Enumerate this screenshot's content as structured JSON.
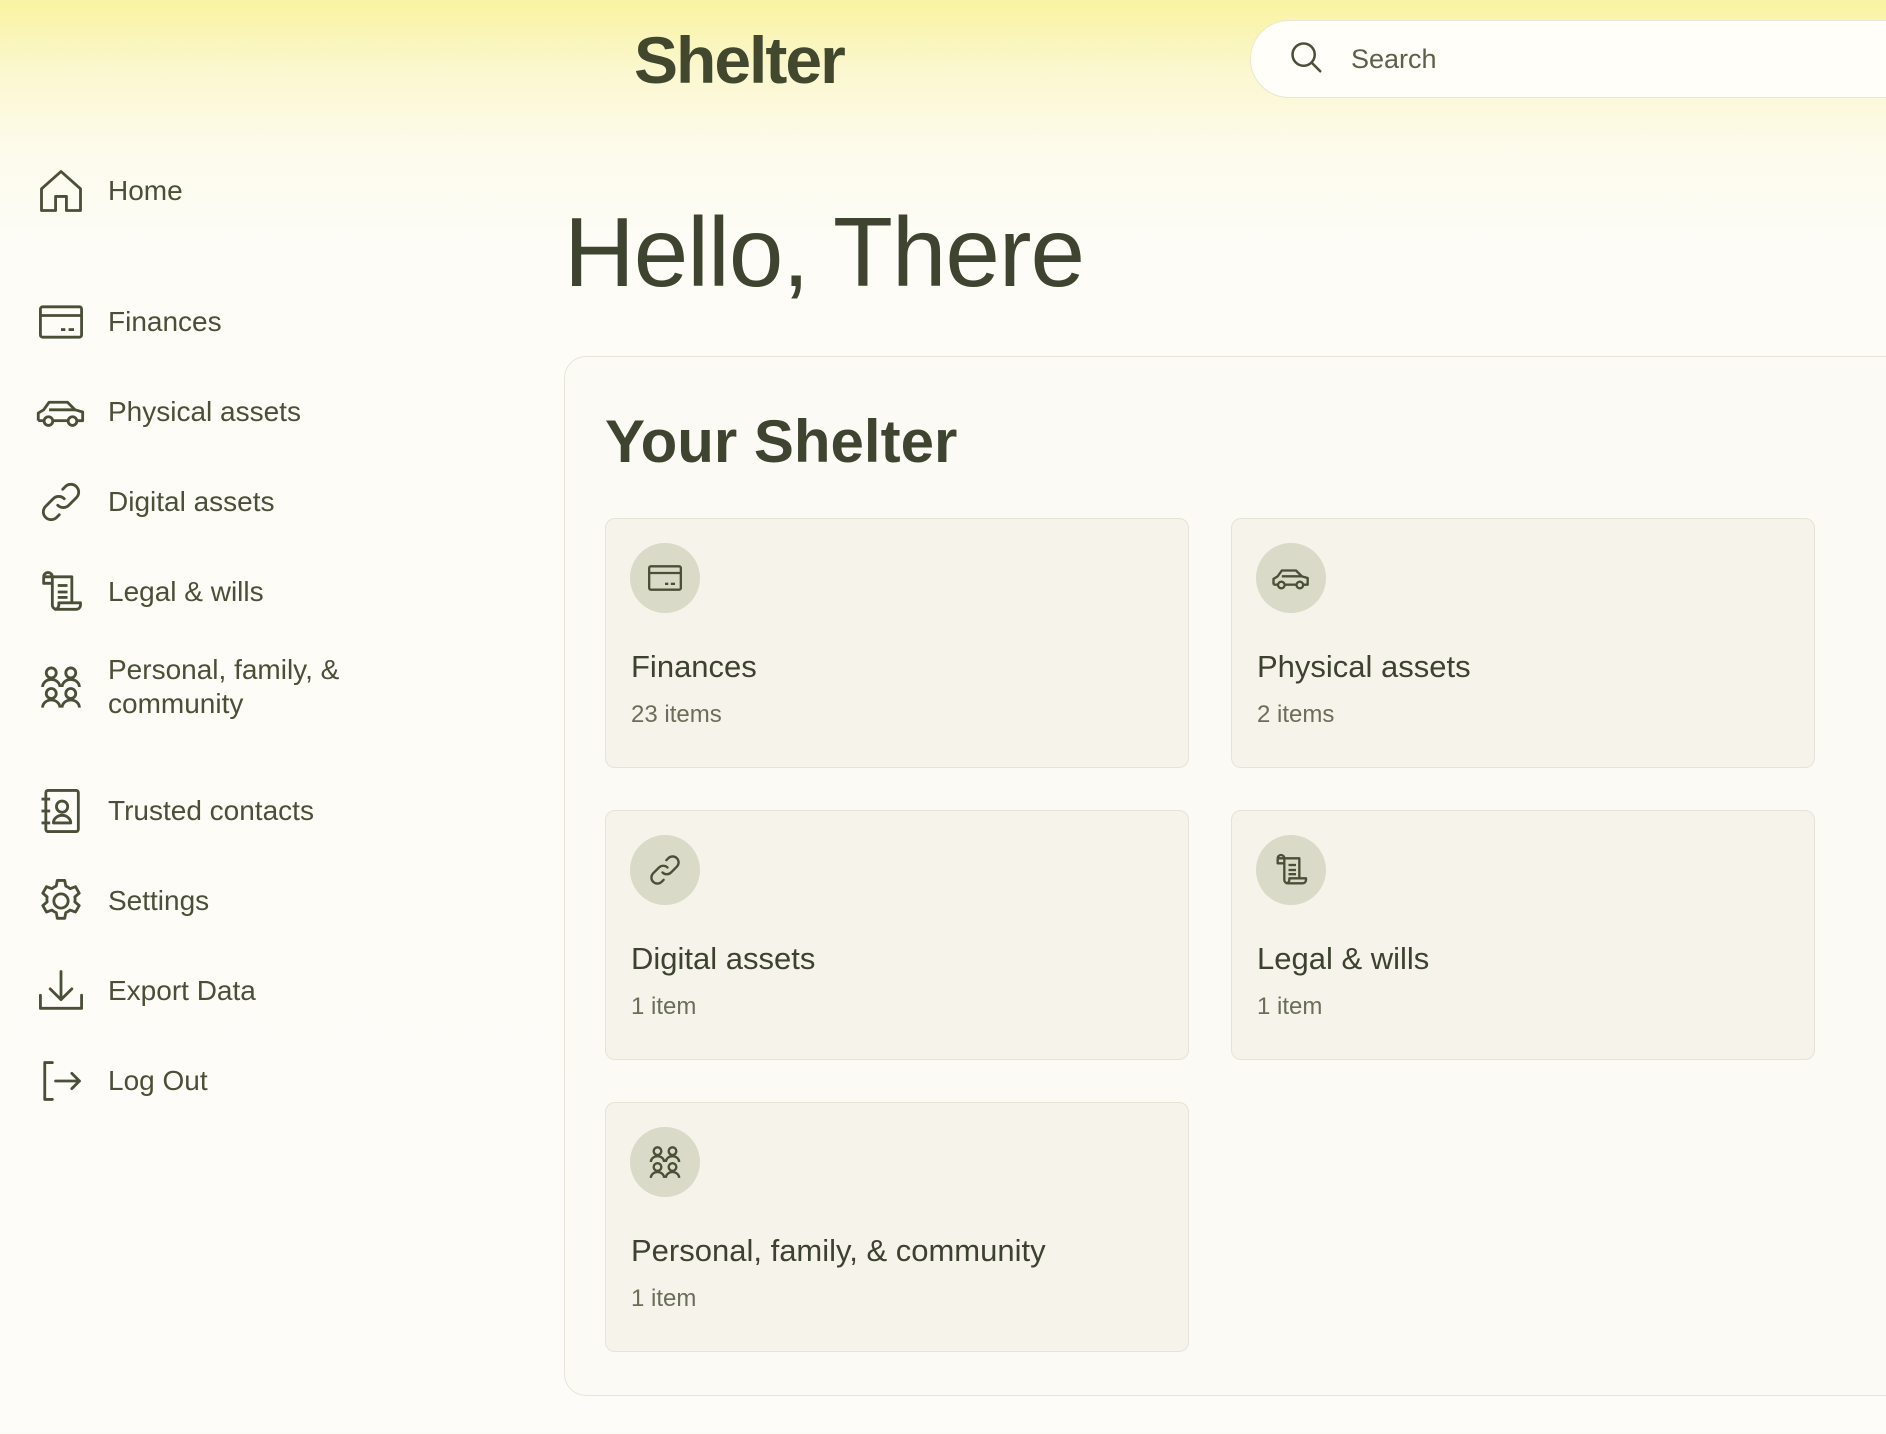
{
  "header": {
    "logo": "Shelter",
    "search_placeholder": "Search"
  },
  "sidebar": {
    "items": [
      {
        "label": "Home",
        "icon": "home-icon"
      },
      {
        "label": "Finances",
        "icon": "credit-card-icon"
      },
      {
        "label": "Physical assets",
        "icon": "car-icon"
      },
      {
        "label": "Digital assets",
        "icon": "link-icon"
      },
      {
        "label": "Legal & wills",
        "icon": "scroll-icon"
      },
      {
        "label": "Personal, family, & community",
        "icon": "people-icon"
      },
      {
        "label": "Trusted contacts",
        "icon": "contact-book-icon"
      },
      {
        "label": "Settings",
        "icon": "gear-icon"
      },
      {
        "label": "Export Data",
        "icon": "download-icon"
      },
      {
        "label": "Log Out",
        "icon": "logout-icon"
      }
    ]
  },
  "main": {
    "greeting": "Hello, There",
    "panel_title": "Your Shelter",
    "cards": [
      {
        "title": "Finances",
        "count": "23 items",
        "icon": "credit-card-icon"
      },
      {
        "title": "Physical assets",
        "count": "2 items",
        "icon": "car-icon"
      },
      {
        "title": "Digital assets",
        "count": "1 item",
        "icon": "link-icon"
      },
      {
        "title": "Legal & wills",
        "count": "1 item",
        "icon": "scroll-icon"
      },
      {
        "title": "Personal, family, & community",
        "count": "1 item",
        "icon": "people-icon"
      }
    ]
  },
  "colors": {
    "text": "#3f4530",
    "badge": "#d9dac7",
    "card_bg": "#f5f3ea",
    "header_yellow": "#f9f3a0"
  }
}
